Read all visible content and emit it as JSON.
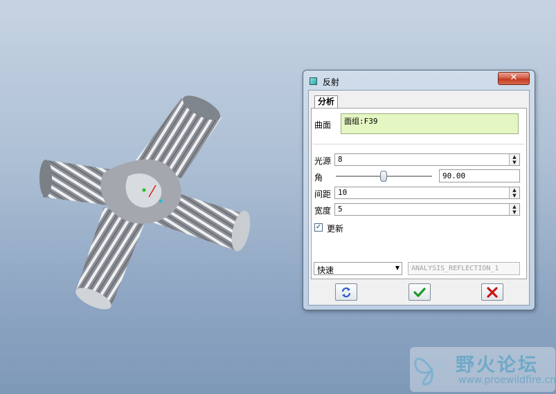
{
  "dialog": {
    "title": "反射",
    "close_label": "✕",
    "tab_label": "分析",
    "surface_label": "曲面",
    "surface_value": "面组:F39",
    "light_label": "光源",
    "light_value": "8",
    "angle_label": "角",
    "angle_value": "90.00",
    "spacing_label": "间距",
    "spacing_value": "10",
    "width_label": "宽度",
    "width_value": "5",
    "update_label": "更新",
    "update_checked": true,
    "mode_value": "快速",
    "analysis_name": "ANALYSIS_REFLECTION_1",
    "buttons": [
      "refresh-icon",
      "check-icon",
      "cancel-icon"
    ],
    "colors": {
      "confirm": "#1a9a2a",
      "cancel": "#c81818",
      "surface_bg": "#e4f6c2"
    }
  },
  "watermark": {
    "title": "野火论坛",
    "url": "www.proewildfire.cn"
  }
}
